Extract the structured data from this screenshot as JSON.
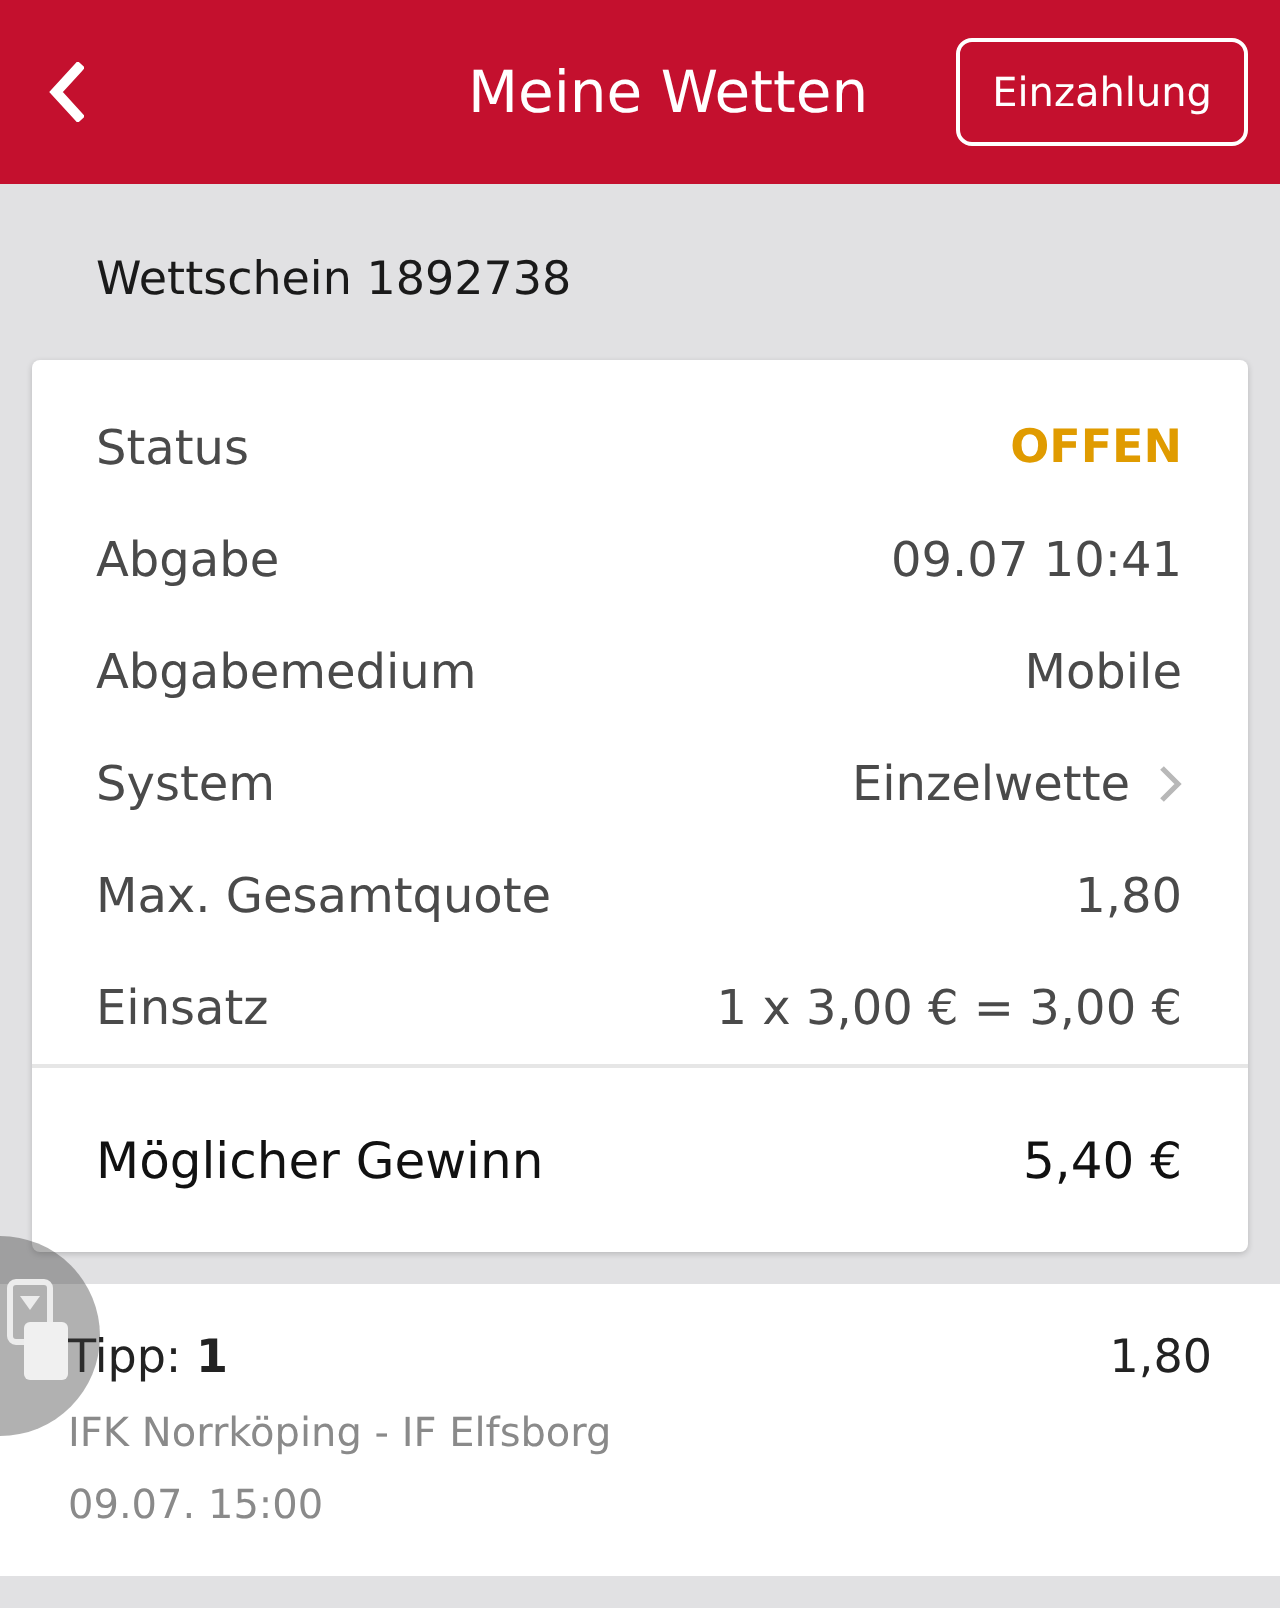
{
  "header": {
    "title": "Meine Wetten",
    "action": "Einzahlung"
  },
  "ticket": {
    "title": "Wettschein 1892738",
    "details": [
      {
        "label": "Status",
        "value": "OFFEN",
        "kind": "status",
        "color": "#e09b00"
      },
      {
        "label": "Abgabe",
        "value": "09.07 10:41",
        "kind": "plain"
      },
      {
        "label": "Abgabemedium",
        "value": "Mobile",
        "kind": "plain"
      },
      {
        "label": "System",
        "value": "Einzelwette",
        "kind": "link"
      },
      {
        "label": "Max. Gesamtquote",
        "value": "1,80",
        "kind": "plain"
      },
      {
        "label": "Einsatz",
        "value": "1 x 3,00 € = 3,00 €",
        "kind": "plain"
      }
    ],
    "total": {
      "label": "Möglicher Gewinn",
      "value": "5,40 €"
    }
  },
  "selections": [
    {
      "tip": "Tipp: **1**",
      "odds": "1,80",
      "match": "IFK Norrköping - IF Elfsborg",
      "time": "09.07. 15:00"
    }
  ]
}
